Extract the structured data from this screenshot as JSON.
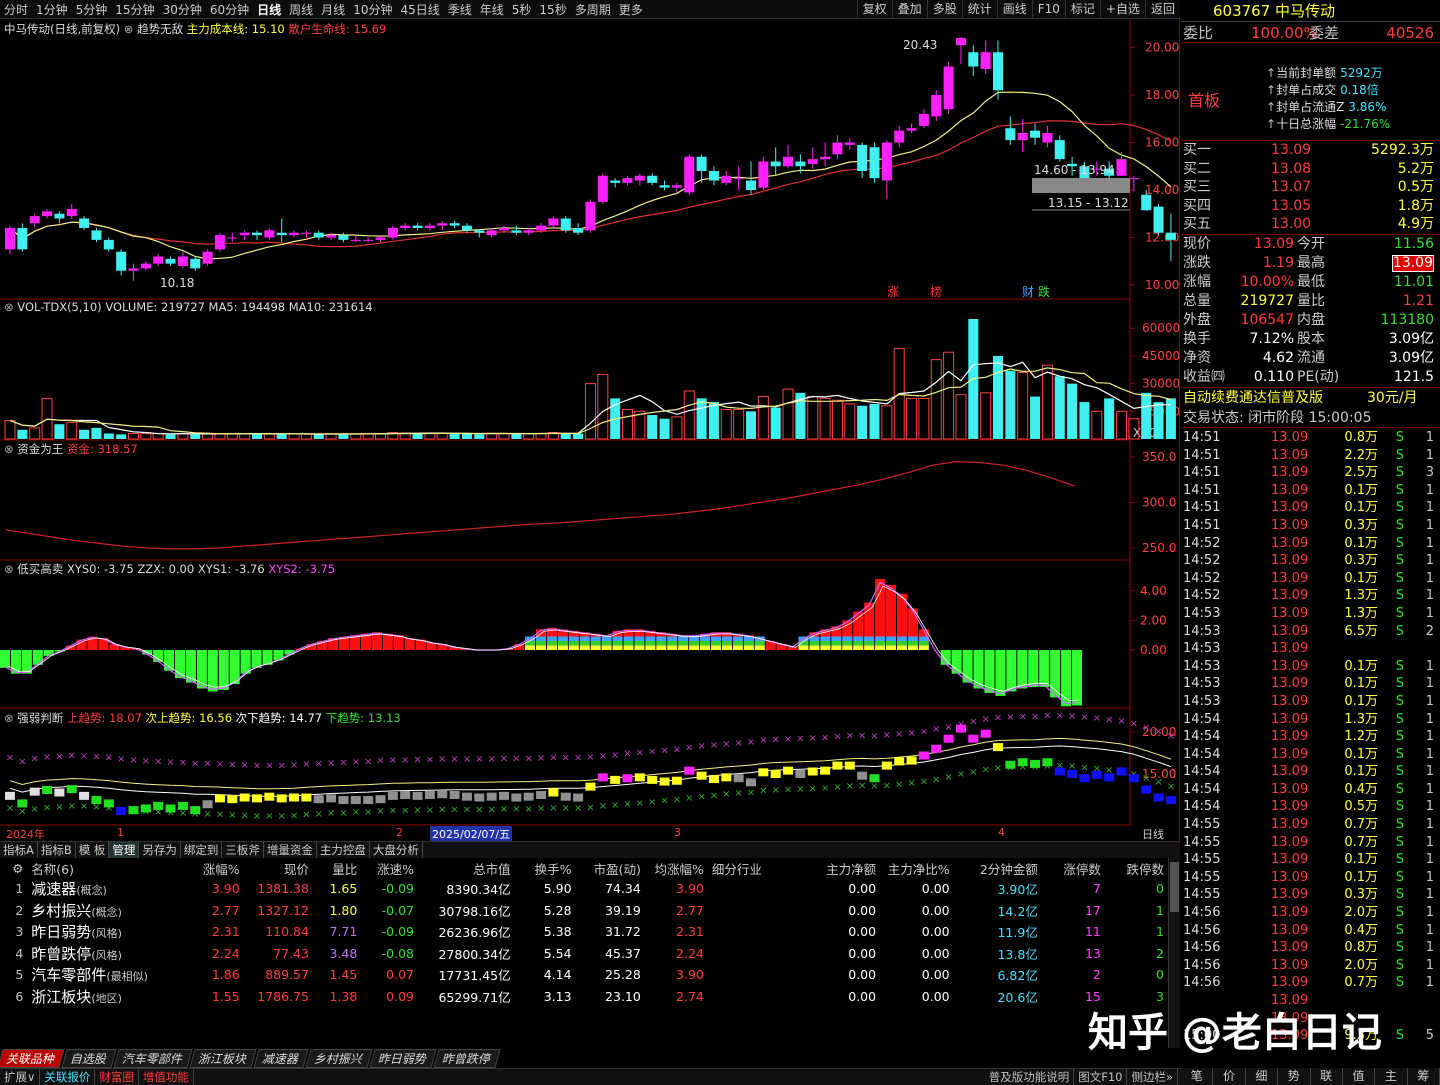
{
  "topbar": {
    "items": [
      "分时",
      "1分钟",
      "5分钟",
      "15分钟",
      "30分钟",
      "60分钟",
      "日线",
      "周线",
      "月线",
      "10分钟",
      "45日线",
      "季线",
      "年线",
      "5秒",
      "15秒",
      "多周期",
      "更多"
    ],
    "active": "日线",
    "tools": [
      "复权",
      "叠加",
      "多股",
      "统计",
      "画线",
      "F10",
      "标记",
      "+自选",
      "返回"
    ]
  },
  "stock": {
    "code": "603767",
    "name": "中马传动"
  },
  "main_panel": {
    "title": "中马传动(日线,前复权)",
    "indicator": "趋势无敌",
    "cost_label": "主力成本线: 15.10",
    "life_label": "散户生命线: 15.69",
    "high_label": "20.43",
    "low_label": "10.18",
    "range1": "14.60 - 13.94",
    "range2": "13.15 - 13.12",
    "markers": [
      "涨",
      "榜",
      "财",
      "跌"
    ],
    "ticks": [
      "20.00",
      "18.00",
      "16.00",
      "14.00",
      "12.00",
      "10.00"
    ]
  },
  "vol_panel": {
    "title": "VOL-TDX(5,10)",
    "values": "VOLUME: 219727  MA5: 194498  MA10: 231614",
    "ticks": [
      "60000",
      "45000",
      "30000",
      "15000"
    ],
    "unit": "X10"
  },
  "fund_panel": {
    "title": "资金为王",
    "value": "资金: 318.57",
    "ticks": [
      "350.0",
      "300.0",
      "250.0"
    ]
  },
  "lowbuy_panel": {
    "title": "低买高卖",
    "values": "XYS0: -3.75  ZZX: 0.00  XYS1: -3.76",
    "xys2": "XYS2: -3.75",
    "ticks": [
      "4.00",
      "2.00",
      "0.00"
    ]
  },
  "strength_panel": {
    "title": "强弱判断",
    "up": "上趋势: 18.07",
    "up2": "次上趋势: 16.56",
    "down2": "次下趋势: 14.77",
    "down": "下趋势: 13.13",
    "ticks": [
      "20.00",
      "15.00"
    ]
  },
  "date_axis": {
    "year": "2024年",
    "m1": "1",
    "m2": "2",
    "date": "2025/02/07/五",
    "m3": "3",
    "m4": "4",
    "period": "日线"
  },
  "tabs": [
    "指标A",
    "指标B",
    "模 板",
    "管理",
    "另存为",
    "绑定到",
    "三板斧",
    "增量资金",
    "主力控盘",
    "大盘分析"
  ],
  "table": {
    "headers": [
      "名称(6)",
      "涨幅%",
      "现价",
      "量比",
      "涨速%",
      "总市值",
      "换手%",
      "市盈(动)",
      "均涨幅%",
      "细分行业",
      "主力净额",
      "主力净比%",
      "2分钟金额",
      "涨停数",
      "跌停数"
    ],
    "rows": [
      [
        "1",
        "减速器",
        "(概念)",
        "3.90",
        "1381.38",
        "1.65",
        "-0.09",
        "8390.34亿",
        "5.90",
        "74.34",
        "3.90",
        "",
        "0.00",
        "0.00",
        "3.90亿",
        "7",
        "0"
      ],
      [
        "2",
        "乡村振兴",
        "(概念)",
        "2.77",
        "1327.12",
        "1.80",
        "-0.07",
        "30798.16亿",
        "5.28",
        "39.19",
        "2.77",
        "",
        "0.00",
        "0.00",
        "14.2亿",
        "17",
        "1"
      ],
      [
        "3",
        "昨日弱势",
        "(风格)",
        "2.31",
        "110.84",
        "7.71",
        "-0.09",
        "26236.96亿",
        "5.38",
        "31.72",
        "2.31",
        "",
        "0.00",
        "0.00",
        "11.9亿",
        "11",
        "1"
      ],
      [
        "4",
        "昨曾跌停",
        "(风格)",
        "2.24",
        "77.43",
        "3.48",
        "-0.08",
        "27800.34亿",
        "5.54",
        "45.37",
        "2.24",
        "",
        "0.00",
        "0.00",
        "13.8亿",
        "13",
        "2"
      ],
      [
        "5",
        "汽车零部件",
        "(最相似)",
        "1.86",
        "889.57",
        "1.45",
        "0.07",
        "17731.45亿",
        "4.14",
        "25.28",
        "3.90",
        "",
        "0.00",
        "0.00",
        "6.82亿",
        "2",
        "0"
      ],
      [
        "6",
        "浙江板块",
        "(地区)",
        "1.55",
        "1786.75",
        "1.38",
        "0.09",
        "65299.71亿",
        "3.13",
        "23.10",
        "2.74",
        "",
        "0.00",
        "0.00",
        "20.6亿",
        "15",
        "3"
      ]
    ]
  },
  "sectabs": [
    "关联品种",
    "自选股",
    "汽车零部件",
    "浙江板块",
    "减速器",
    "乡村振兴",
    "昨日弱势",
    "昨曾跌停"
  ],
  "status": [
    "扩展∨",
    "关联报价",
    "财富圈",
    "增值功能"
  ],
  "status_right": [
    "普及版功能说明",
    "图文F10",
    "侧边栏»"
  ],
  "quote": {
    "weibi_label": "委比",
    "weibi": "100.00%",
    "weicha_label": "委差",
    "weicha": "40526",
    "first_board": "首板",
    "seal": [
      [
        "当前封单额",
        "5292万"
      ],
      [
        "封单占成交",
        "0.18倍"
      ],
      [
        "封单占流通Z",
        "3.86%"
      ],
      [
        "十日总涨幅",
        "-21.76%"
      ]
    ],
    "bids": [
      [
        "买一",
        "13.09",
        "5292.3万"
      ],
      [
        "买二",
        "13.08",
        "5.2万"
      ],
      [
        "买三",
        "13.07",
        "0.5万"
      ],
      [
        "买四",
        "13.05",
        "1.8万"
      ],
      [
        "买五",
        "13.00",
        "4.9万"
      ]
    ],
    "stats": [
      [
        "现价",
        "13.09",
        "今开",
        "11.56"
      ],
      [
        "涨跌",
        "1.19",
        "最高",
        "13.09"
      ],
      [
        "涨幅",
        "10.00%",
        "最低",
        "11.01"
      ],
      [
        "总量",
        "219727",
        "量比",
        "1.21"
      ],
      [
        "外盘",
        "106547",
        "内盘",
        "113180"
      ],
      [
        "换手",
        "7.12%",
        "股本",
        "3.09亿"
      ],
      [
        "净资",
        "4.62",
        "流通",
        "3.09亿"
      ],
      [
        "收益㈣",
        "0.110",
        "PE(动)",
        "121.5"
      ]
    ],
    "ad": "自动续费通达信普及版",
    "price": "30元/月",
    "state": "交易状态: 闭市阶段 15:00:05"
  },
  "ticks_list": [
    [
      "14:51",
      "13.09",
      "0.8万",
      "S",
      "1"
    ],
    [
      "14:51",
      "13.09",
      "2.2万",
      "S",
      "1"
    ],
    [
      "14:51",
      "13.09",
      "2.5万",
      "S",
      "3"
    ],
    [
      "14:51",
      "13.09",
      "0.1万",
      "S",
      "1"
    ],
    [
      "14:51",
      "13.09",
      "0.1万",
      "S",
      "1"
    ],
    [
      "14:51",
      "13.09",
      "0.3万",
      "S",
      "1"
    ],
    [
      "14:52",
      "13.09",
      "0.1万",
      "S",
      "1"
    ],
    [
      "14:52",
      "13.09",
      "0.3万",
      "S",
      "1"
    ],
    [
      "14:52",
      "13.09",
      "0.1万",
      "S",
      "1"
    ],
    [
      "14:52",
      "13.09",
      "1.3万",
      "S",
      "1"
    ],
    [
      "14:53",
      "13.09",
      "1.3万",
      "S",
      "1"
    ],
    [
      "14:53",
      "13.09",
      "6.5万",
      "S",
      "2"
    ],
    [
      "14:53",
      "13.09",
      "",
      "",
      ""
    ],
    [
      "14:53",
      "13.09",
      "0.1万",
      "S",
      "1"
    ],
    [
      "14:53",
      "13.09",
      "0.1万",
      "S",
      "1"
    ],
    [
      "14:53",
      "13.09",
      "0.1万",
      "S",
      "1"
    ],
    [
      "14:54",
      "13.09",
      "1.3万",
      "S",
      "1"
    ],
    [
      "14:54",
      "13.09",
      "1.2万",
      "S",
      "1"
    ],
    [
      "14:54",
      "13.09",
      "0.1万",
      "S",
      "1"
    ],
    [
      "14:54",
      "13.09",
      "0.1万",
      "S",
      "1"
    ],
    [
      "14:54",
      "13.09",
      "0.4万",
      "S",
      "1"
    ],
    [
      "14:54",
      "13.09",
      "0.5万",
      "S",
      "1"
    ],
    [
      "14:55",
      "13.09",
      "0.7万",
      "S",
      "1"
    ],
    [
      "14:55",
      "13.09",
      "0.7万",
      "S",
      "1"
    ],
    [
      "14:55",
      "13.09",
      "0.1万",
      "S",
      "1"
    ],
    [
      "14:55",
      "13.09",
      "0.1万",
      "S",
      "1"
    ],
    [
      "14:55",
      "13.09",
      "0.3万",
      "S",
      "1"
    ],
    [
      "14:56",
      "13.09",
      "2.0万",
      "S",
      "1"
    ],
    [
      "14:56",
      "13.09",
      "0.4万",
      "S",
      "1"
    ],
    [
      "14:56",
      "13.09",
      "0.8万",
      "S",
      "1"
    ],
    [
      "14:56",
      "13.09",
      "2.0万",
      "S",
      "1"
    ],
    [
      "14:56",
      "13.09",
      "0.7万",
      "S",
      "1"
    ],
    [
      "",
      "13.09",
      "",
      "",
      ""
    ],
    [
      "",
      "13.09",
      "",
      "",
      ""
    ],
    [
      "15:00",
      "13.09",
      "9.3万",
      "S",
      "5"
    ]
  ],
  "rtabs": [
    "笔",
    "价",
    "细",
    "势",
    "联",
    "值",
    "主",
    "筹"
  ],
  "watermark": "知乎 @老白日记",
  "candles": [
    [
      11.5,
      12.4,
      11.3,
      12.5
    ],
    [
      12.4,
      11.5,
      11.4,
      12.6
    ],
    [
      12.6,
      12.9,
      12.4,
      13.0
    ],
    [
      12.9,
      13.1,
      12.8,
      13.2
    ],
    [
      13.0,
      12.8,
      12.6,
      13.1
    ],
    [
      12.9,
      13.2,
      12.8,
      13.4
    ],
    [
      12.8,
      12.4,
      12.3,
      12.9
    ],
    [
      12.3,
      11.9,
      11.8,
      12.4
    ],
    [
      11.9,
      11.5,
      11.4,
      12.0
    ],
    [
      11.4,
      10.6,
      10.4,
      11.5
    ],
    [
      10.6,
      10.7,
      10.18,
      10.9
    ],
    [
      10.7,
      10.9,
      10.6,
      11.0
    ],
    [
      10.9,
      11.2,
      10.8,
      11.3
    ],
    [
      11.1,
      10.9,
      10.8,
      11.2
    ],
    [
      10.8,
      11.2,
      10.7,
      11.4
    ],
    [
      11.1,
      10.7,
      10.6,
      11.2
    ],
    [
      10.9,
      11.4,
      10.8,
      11.5
    ],
    [
      11.5,
      12.1,
      11.4,
      12.2
    ],
    [
      12.0,
      12.0,
      11.8,
      12.2
    ],
    [
      12.1,
      12.2,
      11.9,
      12.3
    ],
    [
      12.2,
      12.1,
      11.9,
      12.3
    ],
    [
      12.0,
      12.3,
      11.9,
      12.4
    ],
    [
      12.2,
      12.1,
      11.8,
      12.8
    ],
    [
      12.1,
      12.2,
      12.0,
      12.3
    ],
    [
      12.2,
      12.2,
      12.0,
      12.3
    ],
    [
      12.2,
      12.0,
      11.9,
      12.3
    ],
    [
      12.0,
      12.1,
      11.9,
      12.2
    ],
    [
      12.1,
      11.9,
      11.8,
      12.2
    ],
    [
      11.9,
      11.9,
      11.8,
      12.1
    ],
    [
      11.9,
      11.9,
      11.8,
      12.0
    ],
    [
      11.9,
      12.0,
      11.8,
      12.1
    ],
    [
      12.0,
      12.4,
      11.9,
      12.5
    ],
    [
      12.4,
      12.5,
      12.3,
      12.6
    ],
    [
      12.5,
      12.4,
      12.3,
      12.6
    ],
    [
      12.4,
      12.5,
      12.3,
      12.6
    ],
    [
      12.5,
      12.6,
      12.3,
      12.7
    ],
    [
      12.6,
      12.5,
      12.4,
      12.7
    ],
    [
      12.5,
      12.3,
      12.2,
      12.6
    ],
    [
      12.3,
      12.2,
      12.0,
      12.3
    ],
    [
      12.1,
      12.3,
      12.0,
      12.4
    ],
    [
      12.3,
      12.4,
      12.2,
      12.5
    ],
    [
      12.3,
      12.2,
      12.1,
      12.5
    ],
    [
      12.2,
      12.3,
      12.1,
      12.4
    ],
    [
      12.3,
      12.5,
      12.2,
      12.6
    ],
    [
      12.5,
      12.8,
      12.4,
      12.9
    ],
    [
      12.8,
      12.3,
      12.2,
      12.9
    ],
    [
      12.4,
      12.2,
      12.1,
      12.6
    ],
    [
      12.3,
      13.5,
      12.2,
      13.6
    ],
    [
      13.5,
      14.6,
      13.4,
      14.7
    ],
    [
      14.4,
      14.3,
      14.1,
      14.5
    ],
    [
      14.3,
      14.5,
      14.2,
      14.6
    ],
    [
      14.4,
      14.6,
      14.2,
      14.7
    ],
    [
      14.6,
      14.3,
      14.2,
      14.7
    ],
    [
      14.2,
      14.1,
      14.0,
      14.4
    ],
    [
      14.1,
      14.2,
      13.9,
      14.3
    ],
    [
      13.9,
      15.4,
      13.8,
      15.5
    ],
    [
      15.4,
      14.8,
      14.3,
      15.5
    ],
    [
      14.8,
      14.4,
      14.2,
      15.0
    ],
    [
      14.3,
      14.6,
      14.2,
      14.8
    ],
    [
      14.5,
      14.5,
      14.0,
      15.0
    ],
    [
      14.4,
      14.0,
      13.8,
      15.2
    ],
    [
      14.1,
      15.2,
      14.0,
      15.4
    ],
    [
      15.2,
      15.0,
      14.6,
      15.8
    ],
    [
      15.0,
      15.4,
      14.9,
      15.9
    ],
    [
      15.2,
      15.0,
      14.7,
      15.5
    ],
    [
      15.1,
      15.3,
      14.9,
      15.8
    ],
    [
      15.3,
      15.4,
      15.0,
      16.0
    ],
    [
      15.5,
      16.0,
      15.3,
      16.3
    ],
    [
      15.9,
      16.0,
      15.7,
      16.2
    ],
    [
      15.9,
      14.8,
      14.5,
      16.0
    ],
    [
      15.8,
      14.5,
      14.3,
      16.0
    ],
    [
      14.4,
      16.0,
      13.6,
      16.1
    ],
    [
      16.0,
      16.5,
      15.8,
      16.7
    ],
    [
      16.5,
      16.6,
      16.4,
      16.8
    ],
    [
      16.7,
      17.2,
      16.6,
      17.4
    ],
    [
      17.1,
      18.0,
      16.9,
      18.2
    ],
    [
      17.4,
      19.2,
      17.2,
      19.4
    ],
    [
      20.1,
      20.4,
      19.3,
      20.43
    ],
    [
      19.8,
      19.2,
      18.8,
      20.1
    ],
    [
      19.1,
      19.8,
      18.9,
      20.3
    ],
    [
      19.8,
      18.2,
      17.8,
      20.3
    ],
    [
      16.6,
      16.1,
      15.9,
      17.1
    ],
    [
      16.1,
      16.4,
      15.6,
      17.0
    ],
    [
      16.5,
      16.2,
      15.9,
      16.8
    ],
    [
      16.0,
      16.4,
      15.8,
      16.7
    ],
    [
      16.1,
      15.3,
      15.2,
      16.3
    ],
    [
      15.1,
      15.0,
      14.6,
      15.4
    ],
    [
      15.0,
      14.5,
      14.4,
      15.2
    ],
    [
      14.9,
      14.9,
      14.6,
      15.2
    ],
    [
      14.9,
      14.6,
      14.4,
      15.2
    ],
    [
      14.6,
      15.3,
      14.6,
      15.6
    ],
    [
      14.5,
      14.5,
      13.94,
      14.6
    ],
    [
      13.8,
      13.15,
      13.12,
      14.0
    ],
    [
      13.3,
      12.2,
      12.1,
      13.4
    ],
    [
      12.2,
      11.9,
      11.0,
      13.0
    ]
  ],
  "volume": [
    10000,
    5000,
    6000,
    22000,
    8000,
    9000,
    5000,
    6000,
    3000,
    2500,
    3000,
    3000,
    3000,
    2500,
    3000,
    2500,
    2800,
    3000,
    3000,
    2800,
    3000,
    2600,
    2800,
    2800,
    2600,
    2600,
    2800,
    2800,
    2800,
    2800,
    3000,
    3500,
    3200,
    3200,
    3000,
    3000,
    2800,
    3000,
    2500,
    3000,
    3000,
    3000,
    3000,
    3000,
    3500,
    3000,
    3000,
    30000,
    35000,
    22000,
    16000,
    15000,
    13000,
    11000,
    12000,
    26000,
    22000,
    20000,
    16000,
    16000,
    15000,
    23000,
    17000,
    27000,
    25000,
    23000,
    22000,
    21000,
    19000,
    18000,
    19000,
    18000,
    49000,
    22000,
    22000,
    43000,
    47000,
    24000,
    65000,
    25000,
    45000,
    37000,
    36000,
    23000,
    40000,
    34000,
    30000,
    20000,
    15000,
    22000,
    15000,
    11000,
    25000,
    20000,
    22000
  ],
  "fund_line": [
    270,
    266,
    262,
    258,
    255,
    252,
    250,
    249,
    249,
    250,
    252,
    254,
    256,
    258,
    260,
    262,
    264,
    266,
    268,
    270,
    272,
    274,
    276,
    277,
    279,
    281,
    283,
    285,
    287,
    290,
    293,
    297,
    301,
    305,
    310,
    315,
    320,
    326,
    333,
    341,
    345,
    344,
    341,
    335,
    327,
    318
  ],
  "lowbuy": [
    -1.2,
    -1.6,
    -1.6,
    -1.0,
    -0.4,
    -0.1,
    0.3,
    0.7,
    0.9,
    0.8,
    0.4,
    0.2,
    0.1,
    -0.3,
    -0.8,
    -1.4,
    -1.9,
    -2.2,
    -2.6,
    -2.8,
    -2.7,
    -2.3,
    -1.6,
    -1.2,
    -1.0,
    -0.7,
    -0.3,
    0.1,
    0.4,
    0.6,
    0.8,
    0.9,
    1.0,
    1.1,
    1.2,
    1.1,
    1.0,
    0.8,
    0.7,
    0.5,
    0.4,
    0.2,
    0.1,
    0.0,
    0.0,
    0.0,
    0.1,
    0.4,
    0.8,
    1.4,
    1.5,
    1.4,
    1.3,
    1.2,
    1.1,
    1.0,
    1.3,
    1.4,
    1.4,
    1.3,
    1.2,
    1.1,
    1.0,
    1.0,
    1.1,
    1.2,
    1.2,
    1.1,
    1.0,
    0.8,
    0.6,
    0.4,
    0.2,
    0.8,
    1.2,
    1.4,
    1.6,
    2.0,
    2.6,
    3.2,
    4.8,
    4.4,
    3.8,
    2.8,
    1.4,
    0.0,
    -1.0,
    -1.6,
    -2.2,
    -2.6,
    -2.9,
    -3.1,
    -2.8,
    -2.6,
    -2.5,
    -2.5,
    -3.2,
    -3.8,
    -3.75
  ]
}
